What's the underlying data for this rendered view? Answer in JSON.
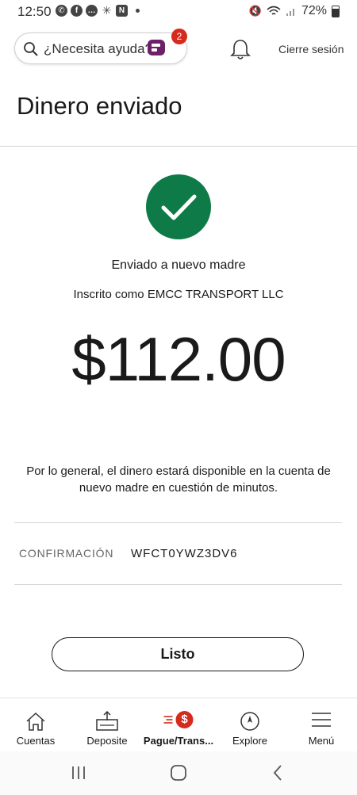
{
  "status_bar": {
    "time": "12:50",
    "battery": "72%"
  },
  "header": {
    "search_placeholder": "¿Necesita ayuda?",
    "assistant_badge": "2",
    "sign_out": "Cierre sesión"
  },
  "page": {
    "title": "Dinero enviado",
    "sent_to": "Enviado a nuevo madre",
    "enrolled_as": "Inscrito como EMCC TRANSPORT LLC",
    "amount": "$112.00",
    "availability": "Por lo general, el dinero estará disponible en la cuenta de nuevo madre en cuestión de minutos.",
    "confirmation_label": "CONFIRMACIÓN",
    "confirmation_code": "WFCT0YWZ3DV6",
    "done_label": "Listo"
  },
  "tabs": [
    {
      "label": "Cuentas",
      "icon": "home-icon"
    },
    {
      "label": "Deposite",
      "icon": "deposit-icon"
    },
    {
      "label": "Pague/Trans...",
      "icon": "transfer-icon",
      "active": true
    },
    {
      "label": "Explore",
      "icon": "compass-icon"
    },
    {
      "label": "Menú",
      "icon": "hamburger-icon"
    }
  ],
  "colors": {
    "accent_red": "#d52b1e",
    "success_green": "#0e7a47",
    "assistant_purple": "#6e1f6a"
  }
}
